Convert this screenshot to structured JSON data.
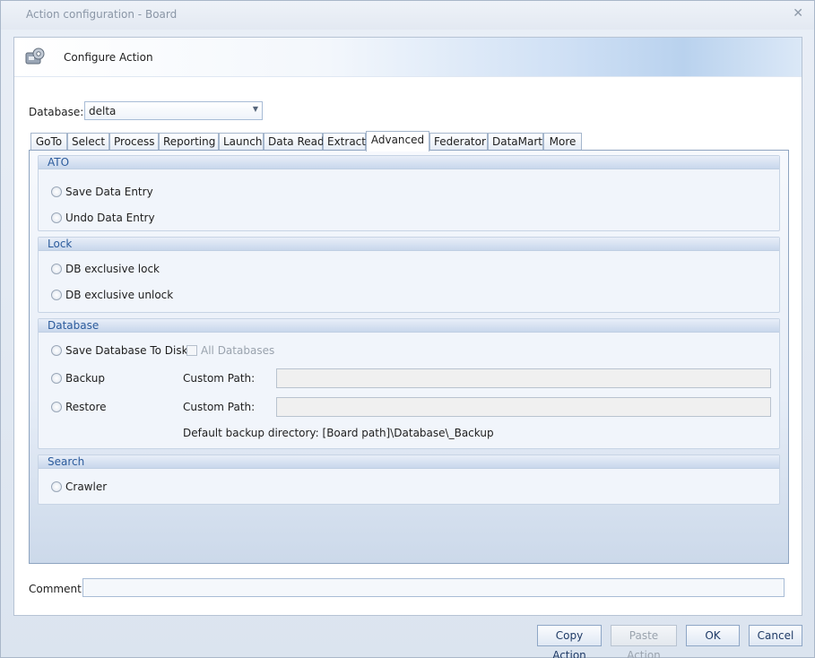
{
  "window": {
    "title": "Action configuration - Board"
  },
  "header": {
    "title": "Configure Action"
  },
  "database": {
    "label": "Database:",
    "value": "delta"
  },
  "tabs": [
    {
      "label": "GoTo"
    },
    {
      "label": "Select"
    },
    {
      "label": "Process"
    },
    {
      "label": "Reporting"
    },
    {
      "label": "Launch"
    },
    {
      "label": "Data Read"
    },
    {
      "label": "Extract"
    },
    {
      "label": "Advanced"
    },
    {
      "label": "Federator"
    },
    {
      "label": "DataMart"
    },
    {
      "label": "More"
    }
  ],
  "active_tab": "Advanced",
  "groups": {
    "ato": {
      "title": "ATO",
      "save": "Save Data Entry",
      "undo": "Undo Data Entry"
    },
    "lock": {
      "title": "Lock",
      "lock": "DB exclusive lock",
      "unlock": "DB exclusive unlock"
    },
    "database": {
      "title": "Database",
      "save_disk": "Save Database To Disk",
      "all_databases": "All Databases",
      "backup": "Backup",
      "restore": "Restore",
      "custom_path_label": "Custom Path:",
      "default_dir": "Default backup directory: [Board path]\\Database\\_Backup"
    },
    "search": {
      "title": "Search",
      "crawler": "Crawler"
    }
  },
  "comment": {
    "label": "Comment:",
    "value": ""
  },
  "buttons": {
    "copy": "Copy Action",
    "paste": "Paste Action",
    "ok": "OK",
    "cancel": "Cancel"
  }
}
